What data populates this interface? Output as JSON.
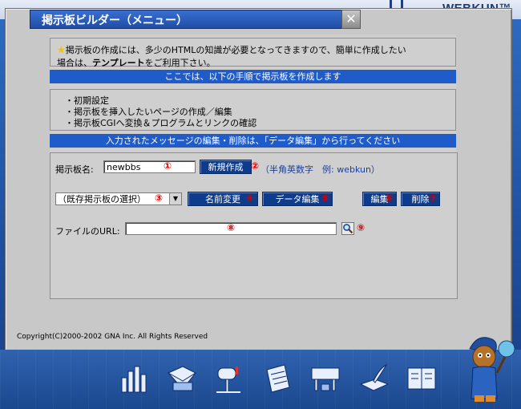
{
  "app": {
    "brand": "WEBKUN™"
  },
  "dialog": {
    "title": "掲示板ビルダー（メニュー）",
    "close_glyph": "✕",
    "notice": {
      "line1": "掲示板の作成には、多少のHTMLの知識が必要となってきますので、簡単に作成したい",
      "line2_prefix": "場合は、",
      "line2_bold": "テンプレート",
      "line2_suffix": "をご利用下さい。"
    },
    "steps_header": "ここでは、以下の手順で掲示板を作成します",
    "steps": [
      "・初期設定",
      "・掲示板を挿入したいページの作成／編集",
      "・掲示板CGIへ変換＆プログラムとリンクの確認"
    ],
    "edit_header": "入力されたメッセージの編集・削除は、「データ編集」から行ってください",
    "form": {
      "board_name_label": "掲示板名:",
      "board_name_value": "newbbs",
      "new_button": "新規作成",
      "hint": "（半角英数字　例: webkun）",
      "select_value": "（既存掲示板の選択）",
      "rename_button": "名前変更",
      "data_edit_button": "データ編集",
      "edit_button": "編集",
      "delete_button": "削除",
      "file_url_label": "ファイルのURL:",
      "file_url_value": ""
    },
    "markers": [
      "①",
      "②",
      "③",
      "④",
      "⑤",
      "⑥",
      "⑦",
      "⑧",
      "⑨"
    ],
    "copyright": "Copyright(C)2000-2002 GNA Inc. All Rights Reserved"
  },
  "taskbar": {
    "icons": [
      "chart-icon",
      "mail-folder-icon",
      "mailbox-icon",
      "form-clipboard-icon",
      "board-builder-icon",
      "quill-book-icon",
      "open-book-icon"
    ]
  },
  "colors": {
    "accent_bar": "#1f5cc9",
    "button": "#0d3c8c",
    "marker": "#d50000",
    "desktop": "#1f55a8"
  }
}
